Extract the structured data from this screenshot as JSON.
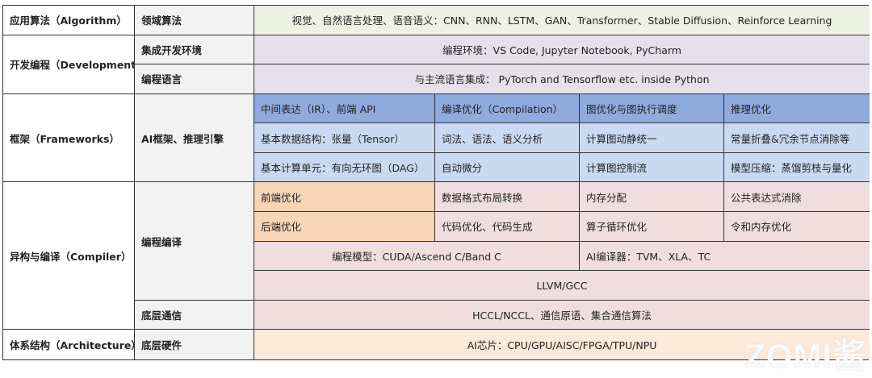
{
  "layers": {
    "algorithm": {
      "label": "应用算法（Algorithm）",
      "sub": "领域算法",
      "content": "视觉、自然语言处理、语音语义：CNN、RNN、LSTM、GAN、Transformer、Stable Diffusion、Reinforce Learning"
    },
    "development": {
      "label": "开发编程（Development）",
      "ide": "集成开发环境",
      "ide_content": "编程环境：VS Code, Jupyter Notebook, PyCharm",
      "lang": "编程语言",
      "lang_content": "与主流语言集成： PyTorch and Tensorflow etc. inside Python"
    },
    "frameworks": {
      "label": "框架（Frameworks）",
      "sub": "AI框架、推理引擎",
      "header": [
        "中间表达（IR）、前端 API",
        "编译优化（Compilation）",
        "图优化与图执行调度",
        "推理优化"
      ],
      "row1": [
        "基本数据结构：张量（Tensor）",
        "词法、语法、语义分析",
        "计算图动静统一",
        "常量折叠&冗余节点消除等"
      ],
      "row2": [
        "基本计算单元：有向无环图（DAG）",
        "自动微分",
        "计算图控制流",
        "模型压缩：蒸馏剪枝与量化"
      ]
    },
    "compiler": {
      "label": "异构与编译（Compiler）",
      "sub": "编程编译",
      "row1": [
        "前端优化",
        "数据格式布局转换",
        "内存分配",
        "公共表达式消除"
      ],
      "row2": [
        "后端优化",
        "代码优化、代码生成",
        "算子循环优化",
        "令和内存优化"
      ],
      "model": "编程模型：CUDA/Ascend C/Band C",
      "ai_compiler": "AI编译器：TVM、XLA、TC",
      "llvm": "LLVM/GCC",
      "comm": "底层通信",
      "comm_content": "HCCL/NCCL、通信原语、集合通信算法"
    },
    "architecture": {
      "label": "体系结构（Architecture）",
      "sub": "底层硬件",
      "content": "AI芯片：CPU/GPU/AISC/FPGA/TPU/NPU"
    }
  },
  "watermark": "ZOMI酱"
}
